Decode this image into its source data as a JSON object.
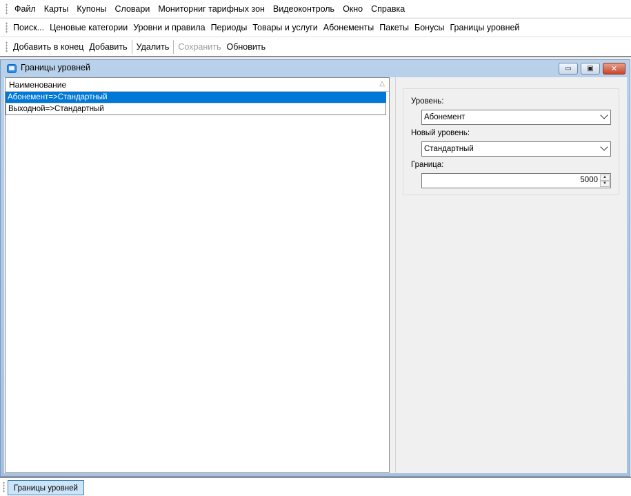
{
  "menu": [
    "Файл",
    "Карты",
    "Купоны",
    "Словари",
    "Мониторниг тарифных зон",
    "Видеоконтроль",
    "Окно",
    "Справка"
  ],
  "nav": [
    "Поиск...",
    "Ценовые категории",
    "Уровни и правила",
    "Периоды",
    "Товары и услуги",
    "Абонементы",
    "Пакеты",
    "Бонусы",
    "Границы уровней"
  ],
  "toolbar": {
    "add_end": "Добавить в конец",
    "add": "Добавить",
    "delete": "Удалить",
    "save": "Сохранить",
    "refresh": "Обновить"
  },
  "window": {
    "title": "Границы уровней",
    "min_glyph": "▭",
    "max_glyph": "▣",
    "close_glyph": "✕"
  },
  "grid": {
    "column": "Наименование",
    "sort_glyph": "△",
    "rows": [
      "Абонемент=>Стандартный",
      "Выходной=>Стандартный"
    ],
    "selected_index": 0
  },
  "form": {
    "level_label": "Уровень:",
    "level_value": "Абонемент",
    "new_level_label": "Новый уровень:",
    "new_level_value": "Стандартный",
    "border_label": "Граница:",
    "border_value": "5000",
    "spin_up": "▲",
    "spin_down": "▼"
  },
  "taskbar": {
    "item": "Границы уровней"
  },
  "colors": {
    "selection": "#0078d7",
    "window_frame": "#b9d1ea",
    "close_button": "#c8452c"
  }
}
